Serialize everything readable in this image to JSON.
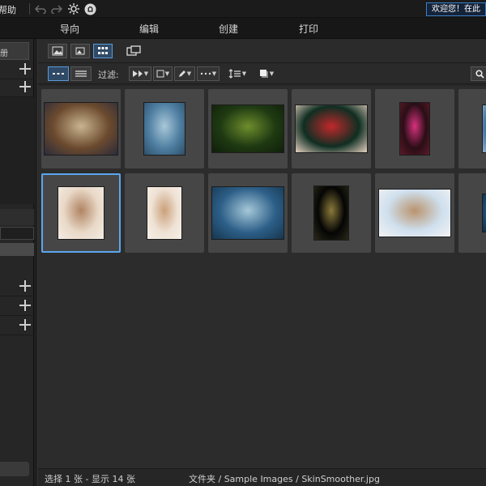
{
  "topbar": {
    "help_menu": "帮助",
    "welcome_text": "欢迎您！在此"
  },
  "modes": [
    "导向",
    "编辑",
    "创建",
    "打印"
  ],
  "left_panel": {
    "tab_label": "册"
  },
  "filter": {
    "label": "过滤:"
  },
  "thumbnails": [
    {
      "name": "basketball-player",
      "colors": [
        "#6b4a2e",
        "#c9b48f",
        "#2b2b3a"
      ]
    },
    {
      "name": "sea-rock-boat",
      "colors": [
        "#4f7fa2",
        "#a9c8d8",
        "#2d4f6a"
      ]
    },
    {
      "name": "forest-sunlight",
      "colors": [
        "#1f3a12",
        "#6e8d2c",
        "#0f1f0a"
      ]
    },
    {
      "name": "red-leaf-hand",
      "colors": [
        "#0f2e22",
        "#c0282a",
        "#e6d0c0"
      ]
    },
    {
      "name": "neon-storefront",
      "colors": [
        "#2a0e16",
        "#d6317d",
        "#5b1a2a"
      ]
    },
    {
      "name": "clouds-partial",
      "colors": [
        "#3a6fa0",
        "#d9dde3",
        "#8fb0cc"
      ]
    },
    {
      "name": "woman-smiling-1",
      "colors": [
        "#e9d9c8",
        "#b08462",
        "#f3ece4"
      ]
    },
    {
      "name": "woman-smiling-2",
      "colors": [
        "#efe2d5",
        "#caa07a",
        "#f6efe7"
      ]
    },
    {
      "name": "ocean-wave",
      "colors": [
        "#2d5f88",
        "#a6c8d9",
        "#16364f"
      ]
    },
    {
      "name": "dark-window",
      "colors": [
        "#050505",
        "#8a7a3a",
        "#2a2a1a"
      ]
    },
    {
      "name": "woman-lying",
      "colors": [
        "#cfe0ee",
        "#b9936d",
        "#f2f2f2"
      ]
    },
    {
      "name": "wave-partial",
      "colors": [
        "#1f4f7a",
        "#7ba6c5",
        "#0f2a45"
      ]
    }
  ],
  "status": {
    "selection": "选择 1 张 - 显示 14 张",
    "path": "文件夹 / Sample Images / SkinSmoother.jpg"
  }
}
